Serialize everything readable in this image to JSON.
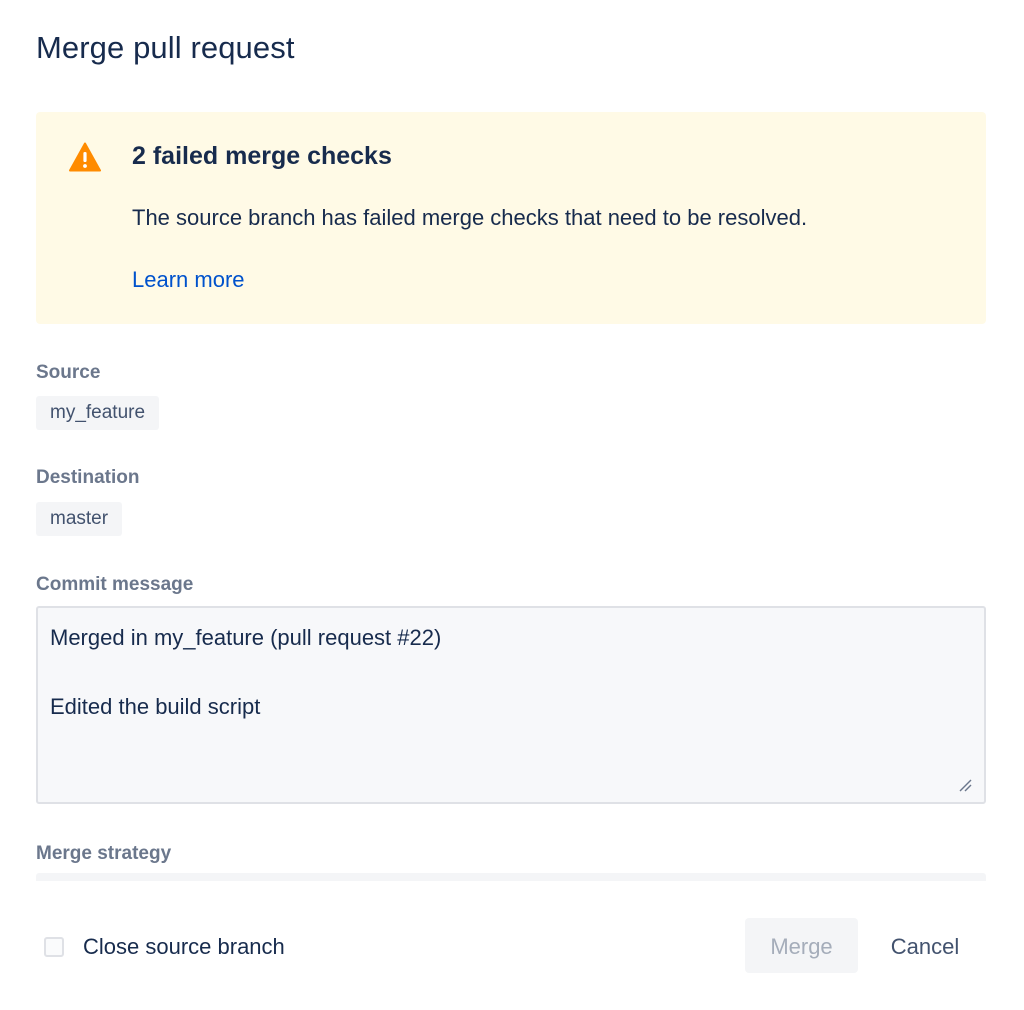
{
  "dialog": {
    "title": "Merge pull request"
  },
  "warning": {
    "icon": "warning-triangle-icon",
    "icon_color": "#ff8b00",
    "background": "#fffae6",
    "heading": "2 failed merge checks",
    "message": "The source branch has failed merge checks that need to be resolved.",
    "link_label": "Learn more"
  },
  "source": {
    "label": "Source",
    "branch": "my_feature"
  },
  "destination": {
    "label": "Destination",
    "branch": "master"
  },
  "commit": {
    "label": "Commit message",
    "line1": "Merged in my_feature (pull request #22)",
    "line2": "Edited the build script"
  },
  "strategy": {
    "label": "Merge strategy"
  },
  "footer": {
    "close_branch_label": "Close source branch",
    "close_branch_checked": false,
    "merge_label": "Merge",
    "cancel_label": "Cancel"
  }
}
